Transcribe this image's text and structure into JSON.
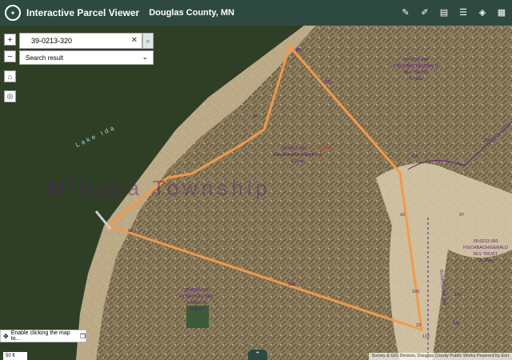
{
  "header": {
    "title": "Interactive Parcel Viewer",
    "county": "Douglas County, MN",
    "tool_icons": [
      "pencil-icon",
      "layers-edit-icon",
      "print-icon",
      "list-icon",
      "layers-icon",
      "basemap-icon"
    ]
  },
  "search": {
    "value": "39-0213-320",
    "result_label": "Search result"
  },
  "map": {
    "township_label": "Miltona Township",
    "water_label": "Lake Ida",
    "parcels": [
      {
        "pin": "39-0213-320",
        "owner": "BRUENNER/SHERRY A",
        "acres": "2.29ac"
      },
      {
        "pin": "39-0213-340",
        "owner": "FISCHBACH/GERALD",
        "acres": "RLV TRUST",
        "extra": "6.79ac"
      },
      {
        "pin": "39-0213-360",
        "owner": "FISCHBACH/GERALD",
        "acres": "RLV TRUST",
        "extra": "10.76ac"
      },
      {
        "pin": "39-0213-310",
        "owner": "ROMINE/NEVAN",
        "acres": "KAREN A",
        "extra": "0.96ac"
      }
    ],
    "dimension_labels": [
      "335",
      "50",
      "221",
      "116",
      "79",
      "97",
      "548",
      "109",
      "113",
      "43",
      "23",
      "290",
      "146",
      "104",
      "61"
    ],
    "road_label": "SUNRISE DR NW",
    "parcel_callout": "21.39ac"
  },
  "status": {
    "text": "Enable clicking the map to..."
  },
  "scale": "50 ft",
  "attribution": "Survey & GIS Division, Douglas County Public Works   Powered by Esri",
  "colors": {
    "header": "#2e4a40",
    "parcel_outline": "#f29a4a",
    "label": "#5c1a7a"
  }
}
